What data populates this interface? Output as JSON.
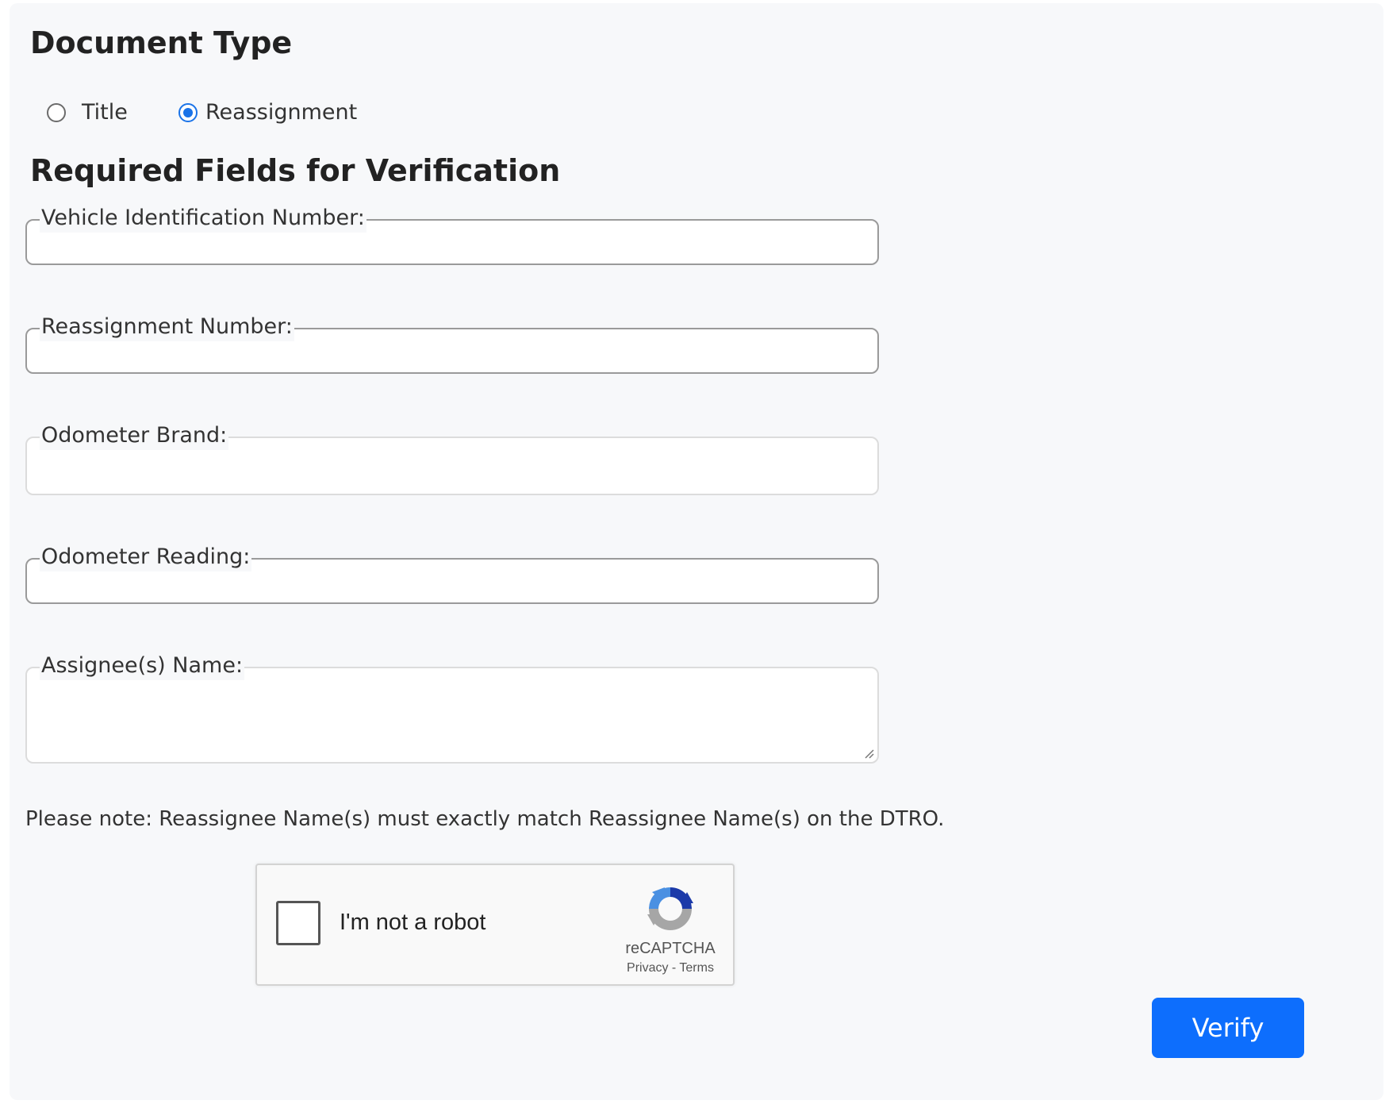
{
  "document_type": {
    "heading": "Document Type",
    "options": [
      {
        "label": "Title",
        "checked": false
      },
      {
        "label": "Reassignment",
        "checked": true
      }
    ]
  },
  "required": {
    "heading": "Required Fields for Verification",
    "fields": [
      {
        "label": "Vehicle Identification Number:",
        "value": ""
      },
      {
        "label": "Reassignment Number:",
        "value": ""
      },
      {
        "label": "Odometer Brand:",
        "value": ""
      },
      {
        "label": "Odometer Reading:",
        "value": ""
      },
      {
        "label": "Assignee(s) Name:",
        "value": ""
      }
    ]
  },
  "note": "Please note: Reassignee Name(s) must exactly match Reassignee Name(s) on the DTRO.",
  "captcha": {
    "checkbox_label": "I'm not a robot",
    "brand": "reCAPTCHA",
    "privacy": "Privacy",
    "separator": " - ",
    "terms": "Terms"
  },
  "verify_button": "Verify",
  "colors": {
    "accent": "#0d6efd",
    "radio_selected": "#1a73e8",
    "panel_bg": "#f7f8fa"
  }
}
